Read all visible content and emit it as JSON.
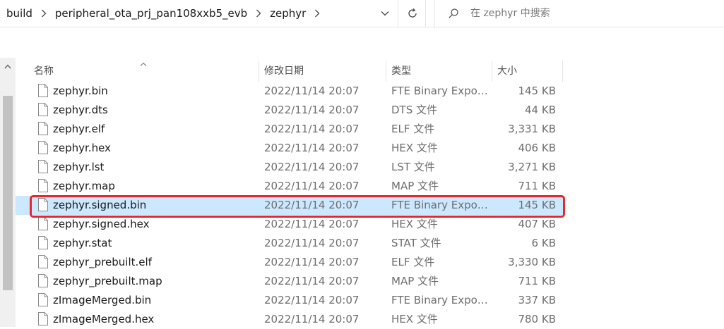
{
  "breadcrumb": {
    "items": [
      "build",
      "peripheral_ota_prj_pan108xxb5_evb",
      "zephyr"
    ]
  },
  "search": {
    "placeholder": "在 zephyr 中搜索"
  },
  "columns": {
    "name": "名称",
    "date": "修改日期",
    "type": "类型",
    "size": "大小"
  },
  "files": [
    {
      "name": "zephyr.bin",
      "date": "2022/11/14 20:07",
      "type": "FTE Binary Exporter",
      "size": "145 KB"
    },
    {
      "name": "zephyr.dts",
      "date": "2022/11/14 20:07",
      "type": "DTS 文件",
      "size": "44 KB"
    },
    {
      "name": "zephyr.elf",
      "date": "2022/11/14 20:07",
      "type": "ELF 文件",
      "size": "3,331 KB"
    },
    {
      "name": "zephyr.hex",
      "date": "2022/11/14 20:07",
      "type": "HEX 文件",
      "size": "406 KB"
    },
    {
      "name": "zephyr.lst",
      "date": "2022/11/14 20:07",
      "type": "LST 文件",
      "size": "3,271 KB"
    },
    {
      "name": "zephyr.map",
      "date": "2022/11/14 20:07",
      "type": "MAP 文件",
      "size": "711 KB"
    },
    {
      "name": "zephyr.signed.bin",
      "date": "2022/11/14 20:07",
      "type": "FTE Binary Exporter",
      "size": "145 KB"
    },
    {
      "name": "zephyr.signed.hex",
      "date": "2022/11/14 20:07",
      "type": "HEX 文件",
      "size": "407 KB"
    },
    {
      "name": "zephyr.stat",
      "date": "2022/11/14 20:07",
      "type": "STAT 文件",
      "size": "6 KB"
    },
    {
      "name": "zephyr_prebuilt.elf",
      "date": "2022/11/14 20:07",
      "type": "ELF 文件",
      "size": "3,330 KB"
    },
    {
      "name": "zephyr_prebuilt.map",
      "date": "2022/11/14 20:07",
      "type": "MAP 文件",
      "size": "711 KB"
    },
    {
      "name": "zImageMerged.bin",
      "date": "2022/11/14 20:07",
      "type": "FTE Binary Exporter",
      "size": "337 KB"
    },
    {
      "name": "zImageMerged.hex",
      "date": "2022/11/14 20:07",
      "type": "HEX 文件",
      "size": "780 KB"
    }
  ],
  "selected_file": "zephyr.signed.bin",
  "colors": {
    "selection": "#cce8ff",
    "highlight_border": "#e8262b"
  },
  "icons": {
    "refresh": "refresh-icon",
    "search": "search-icon",
    "dropdown": "chevron-down-icon",
    "separator": "chevron-right-icon",
    "file": "file-icon"
  }
}
